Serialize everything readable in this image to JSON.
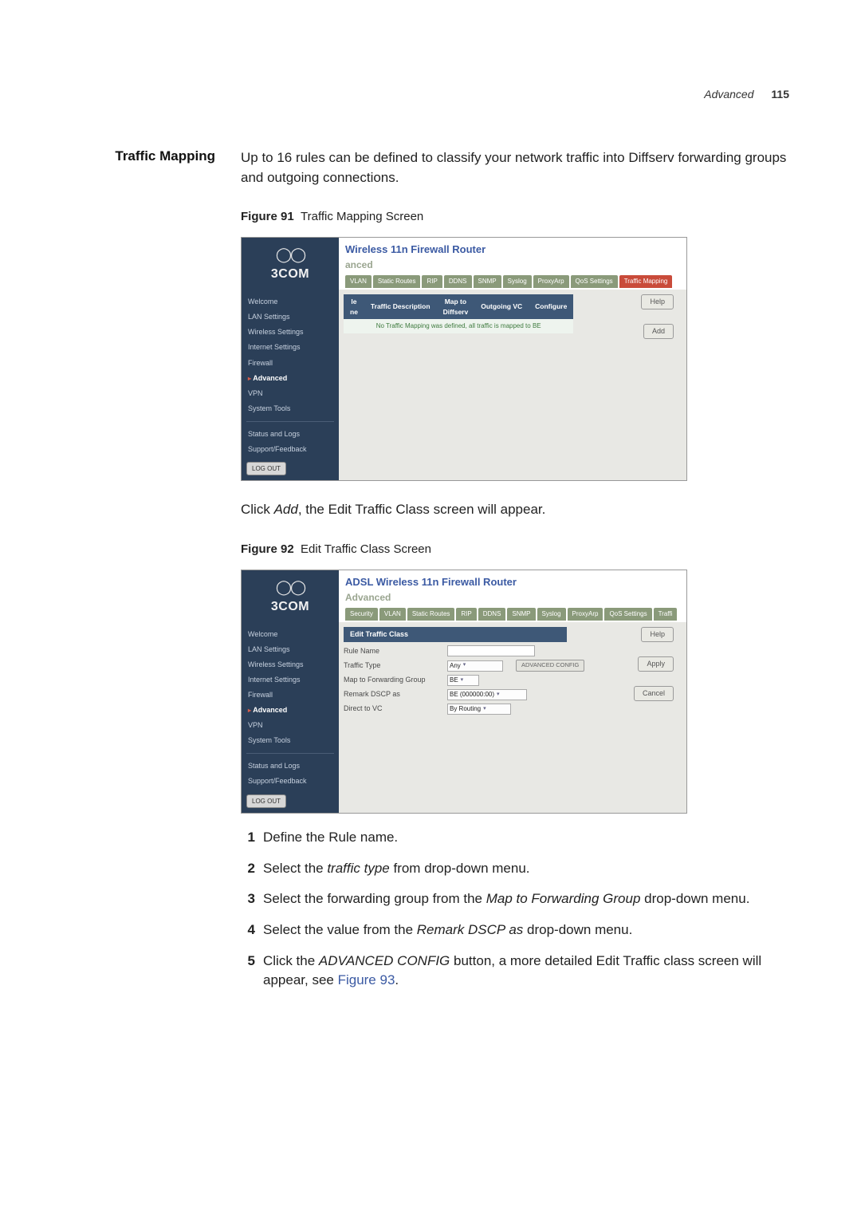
{
  "header": {
    "section": "Advanced",
    "page": "115"
  },
  "section_title": "Traffic Mapping",
  "intro": "Up to 16 rules can be defined to classify your network traffic into Diffserv forwarding groups and outgoing connections.",
  "fig91": {
    "caption_bold": "Figure 91",
    "caption_rest": "Traffic Mapping Screen",
    "logo": "3COM",
    "title": "Wireless 11n Firewall Router",
    "subtitle": "anced",
    "tabs": [
      "VLAN",
      "Static Routes",
      "RIP",
      "DDNS",
      "SNMP",
      "Syslog",
      "ProxyArp",
      "QoS Settings",
      "Traffic Mapping"
    ],
    "active_tab_index": 8,
    "side": [
      "Welcome",
      "LAN Settings",
      "Wireless Settings",
      "Internet Settings",
      "Firewall",
      "Advanced",
      "VPN",
      "System Tools"
    ],
    "side_hlt_index": 5,
    "side_lower": [
      "Status and Logs",
      "Support/Feedback"
    ],
    "logout": "LOG OUT",
    "th": [
      "le\nne",
      "Traffic Description",
      "Map to\nDiffserv",
      "Outgoing VC",
      "Configure"
    ],
    "row_msg": "No Traffic Mapping was defined, all traffic is mapped to BE",
    "btns": [
      "Help",
      "Add"
    ]
  },
  "after91": "Click Add, the Edit Traffic Class screen will appear.",
  "after91_pre": "Click ",
  "after91_em": "Add",
  "after91_post": ", the Edit Traffic Class screen will appear.",
  "fig92": {
    "caption_bold": "Figure 92",
    "caption_rest": "Edit Traffic Class Screen",
    "logo": "3COM",
    "title": "ADSL Wireless 11n Firewall Router",
    "subtitle": "Advanced",
    "tabs": [
      "Security",
      "VLAN",
      "Static Routes",
      "RIP",
      "DDNS",
      "SNMP",
      "Syslog",
      "ProxyArp",
      "QoS Settings",
      "Traffi"
    ],
    "side": [
      "Welcome",
      "LAN Settings",
      "Wireless Settings",
      "Internet Settings",
      "Firewall",
      "Advanced",
      "VPN",
      "System Tools"
    ],
    "side_hlt_index": 5,
    "side_lower": [
      "Status and Logs",
      "Support/Feedback"
    ],
    "logout": "LOG OUT",
    "panel_head": "Edit Traffic Class",
    "labels": {
      "rule": "Rule Name",
      "ttype": "Traffic Type",
      "mfg": "Map to Forwarding Group",
      "rdscp_pre": "Remark DSCP as",
      "dtv": "Direct to VC"
    },
    "values": {
      "ttype": "Any",
      "aconf": "ADVANCED CONFIG",
      "mfg": "BE",
      "rdscp": "BE (000000:00)",
      "dtv": "By Routing"
    },
    "btns": [
      "Help",
      "Apply",
      "Cancel"
    ]
  },
  "steps": [
    {
      "n": "1",
      "text": "Define the Rule name."
    },
    {
      "n": "2",
      "pre": "Select the ",
      "em": "traffic type",
      "post": " from drop-down menu."
    },
    {
      "n": "3",
      "pre": "Select the forwarding group from the ",
      "em": "Map to Forwarding Group",
      "post": " drop-down menu."
    },
    {
      "n": "4",
      "pre": "Select the value from the ",
      "em": "Remark DSCP as",
      "post": " drop-down menu."
    },
    {
      "n": "5",
      "pre": "Click the ",
      "em": "ADVANCED CONFIG",
      "post": " button, a more detailed Edit Traffic class screen will appear, see ",
      "link": "Figure 93",
      "tail": "."
    }
  ]
}
